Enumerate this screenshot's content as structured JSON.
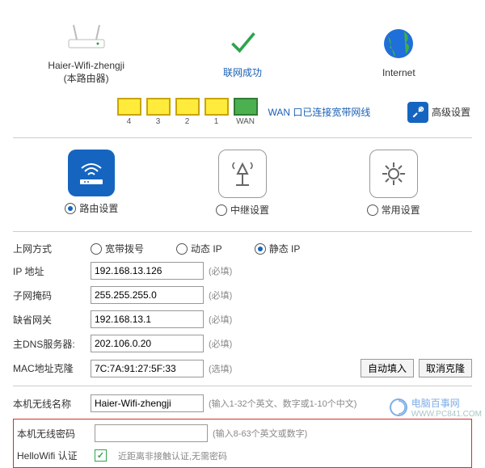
{
  "top": {
    "router_name": "Haier-Wifi-zhengji",
    "router_sub": "(本路由器)",
    "conn_status": "联网成功",
    "internet_label": "Internet"
  },
  "ports": {
    "labels": [
      "4",
      "3",
      "2",
      "1",
      "WAN"
    ],
    "wan_text": "WAN 口已连接宽带网线",
    "adv_label": "高级设置"
  },
  "modes": {
    "route": "路由设置",
    "repeat": "中继设置",
    "common": "常用设置"
  },
  "wan": {
    "method_label": "上网方式",
    "opts": {
      "pppoe": "宽带拨号",
      "dhcp": "动态 IP",
      "static": "静态 IP"
    },
    "ip_label": "IP 地址",
    "ip_value": "192.168.13.126",
    "mask_label": "子网掩码",
    "mask_value": "255.255.255.0",
    "gw_label": "缺省网关",
    "gw_value": "192.168.13.1",
    "dns_label": "主DNS服务器:",
    "dns_value": "202.106.0.20",
    "mac_label": "MAC地址克隆",
    "mac_value": "7C:7A:91:27:5F:33",
    "req": "(必填)",
    "opt": "(选填)",
    "btn_fill": "自动填入",
    "btn_cancel": "取消克隆"
  },
  "wifi": {
    "ssid_label": "本机无线名称",
    "ssid_value": "Haier-Wifi-zhengji",
    "ssid_hint": "(输入1-32个英文、数字或1-10个中文)",
    "pwd_label": "本机无线密码",
    "pwd_value": "",
    "pwd_hint": "(输入8-63个英文或数字)",
    "hello_label": "HelloWifi 认证",
    "hello_desc": "近距离非接触认证,无需密码"
  },
  "watermark": {
    "brand": "电脑百事网",
    "url": "WWW.PC841.COM"
  }
}
